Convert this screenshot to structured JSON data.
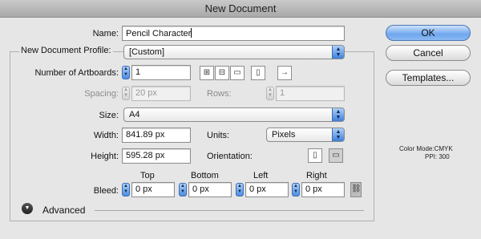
{
  "window": {
    "title": "New Document"
  },
  "name": {
    "label": "Name:",
    "value": "Pencil Character"
  },
  "profile": {
    "label": "New Document Profile:",
    "value": "[Custom]"
  },
  "artboards": {
    "label": "Number of Artboards:",
    "value": "1",
    "icons": [
      "grid-by-row-icon",
      "grid-by-column-icon",
      "arrange-by-row-icon",
      "arrange-by-column-icon",
      "right-to-left-layout-icon"
    ]
  },
  "spacing": {
    "label": "Spacing:",
    "value": "20 px"
  },
  "rows": {
    "label": "Rows:",
    "value": "1"
  },
  "size": {
    "label": "Size:",
    "value": "A4"
  },
  "width": {
    "label": "Width:",
    "value": "841.89 px"
  },
  "units": {
    "label": "Units:",
    "value": "Pixels"
  },
  "height": {
    "label": "Height:",
    "value": "595.28 px"
  },
  "orientation": {
    "label": "Orientation:"
  },
  "bleed": {
    "label": "Bleed:",
    "headers": {
      "top": "Top",
      "bottom": "Bottom",
      "left": "Left",
      "right": "Right"
    },
    "top": "0 px",
    "bottom": "0 px",
    "left": "0 px",
    "right": "0 px"
  },
  "advanced": {
    "label": "Advanced"
  },
  "buttons": {
    "ok": "OK",
    "cancel": "Cancel",
    "templates": "Templates..."
  },
  "info": {
    "color_mode": "Color Mode:CMYK",
    "ppi": "PPI: 300"
  },
  "colors": {
    "accent": "#5f9bea",
    "window_bg": "#e6e6e6"
  }
}
